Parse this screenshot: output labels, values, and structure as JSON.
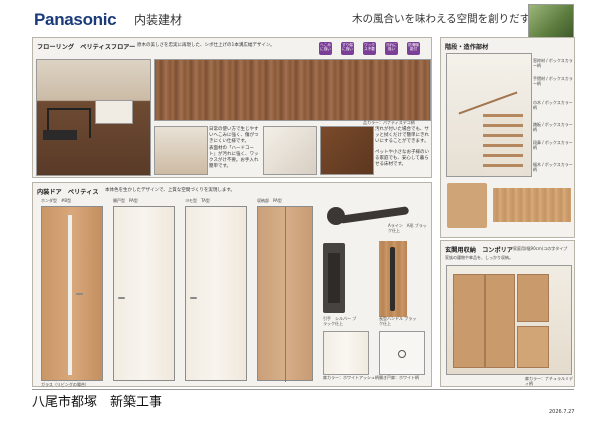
{
  "header": {
    "brand": "Panasonic",
    "title": "内装建材",
    "tagline": "木の風合いを味わえる空間を創りだす。"
  },
  "flooring": {
    "section_title": "フローリング　ベリティスフロアー",
    "description": "原木の美しさを忠実に再現した、シボ仕上げの1本溝広幅デザイン。",
    "badges": [
      "へこみに強い",
      "すり傷に強い",
      "ワックス不要",
      "汚れに強い",
      "防滑機能付"
    ],
    "color_label": "品カラー：パナティスデコ柄",
    "text_block_1": "日常の使い方で生じやすいへこみに強く、傷がつきにくい仕様です。",
    "text_block_2": "表面材の「ハードコート」が汚れに強く、ワックスがけ不要。お手入れ簡単です。",
    "text_block_3": "汚れが付いた場合でも、サッと拭くだけで簡単にきれいにすることができます。",
    "text_block_4": "ペットや小さなお子様のいる家庭でも、安心して暮らせる床材です。"
  },
  "stairs": {
    "section_title": "階段・造作部材",
    "labels": [
      "窓枠材 / ボックスカラー柄",
      "手摺材 / ボックスカラー柄",
      "巾木 / ボックスカラー柄",
      "踏板 / ボックスカラー柄",
      "段鼻 / ボックスカラー柄",
      "幅木 / ボックスカラー柄"
    ]
  },
  "doors": {
    "section_title": "内装ドア　ベリティス",
    "description": "本体色を生かしたデザインで、上質な空間づくりを実現します。",
    "items": [
      {
        "label": "ホンダ型　#B型"
      },
      {
        "label": "開戸型　PA型"
      },
      {
        "label": "ヨモ型　TA型"
      },
      {
        "label": "収納部　PA型"
      }
    ],
    "note_left": "ガラス（リビングの場合）",
    "handles": [
      "Aライン　A形 ブラック仕上",
      "引手　シルバー ブラック仕上",
      "長型ハンドル ブラック仕上"
    ],
    "samples": [
      "扉カラー：ホワイトアッシュ柄",
      "開き戸扉：ホワイト柄"
    ]
  },
  "storage": {
    "section_title": "玄関用収納　コンポリア",
    "spec": "家庭用(幅90cm)コの字タイプ",
    "description": "家族の履物や傘品を、しっかり収納。",
    "color_label": "扉カラー：ナチュラルミディ柄"
  },
  "footer": {
    "project": "八尾市都塚　新築工事",
    "date": "2026.7.27"
  }
}
